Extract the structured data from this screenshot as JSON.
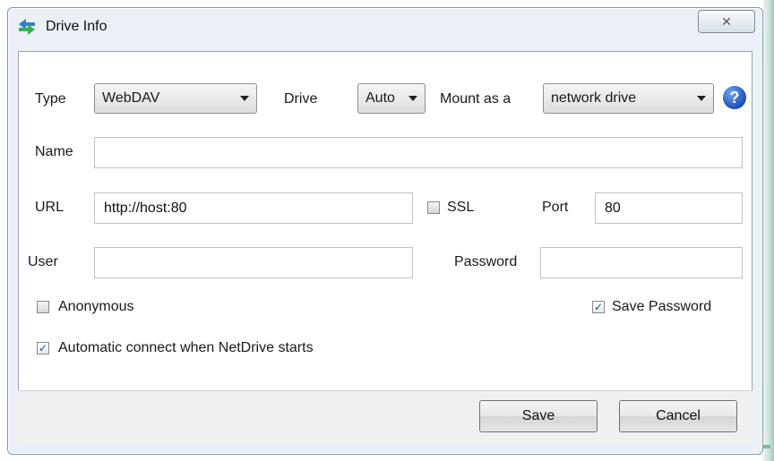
{
  "window": {
    "title": "Drive Info",
    "close_glyph": "✕"
  },
  "form": {
    "type_label": "Type",
    "type_value": "WebDAV",
    "drive_label": "Drive",
    "drive_value": "Auto",
    "mount_label": "Mount as a",
    "mount_value": "network drive",
    "help_glyph": "?",
    "name_label": "Name",
    "name_value": "",
    "url_label": "URL",
    "url_value": "http://host:80",
    "ssl_label": "SSL",
    "ssl_checked": false,
    "port_label": "Port",
    "port_value": "80",
    "user_label": "User",
    "user_value": "",
    "password_label": "Password",
    "password_value": "",
    "anonymous_label": "Anonymous",
    "anonymous_checked": false,
    "save_password_label": "Save Password",
    "save_password_checked": true,
    "auto_connect_label": "Automatic connect when NetDrive starts",
    "auto_connect_checked": true,
    "check_glyph": "✓"
  },
  "footer": {
    "save_label": "Save",
    "cancel_label": "Cancel"
  }
}
